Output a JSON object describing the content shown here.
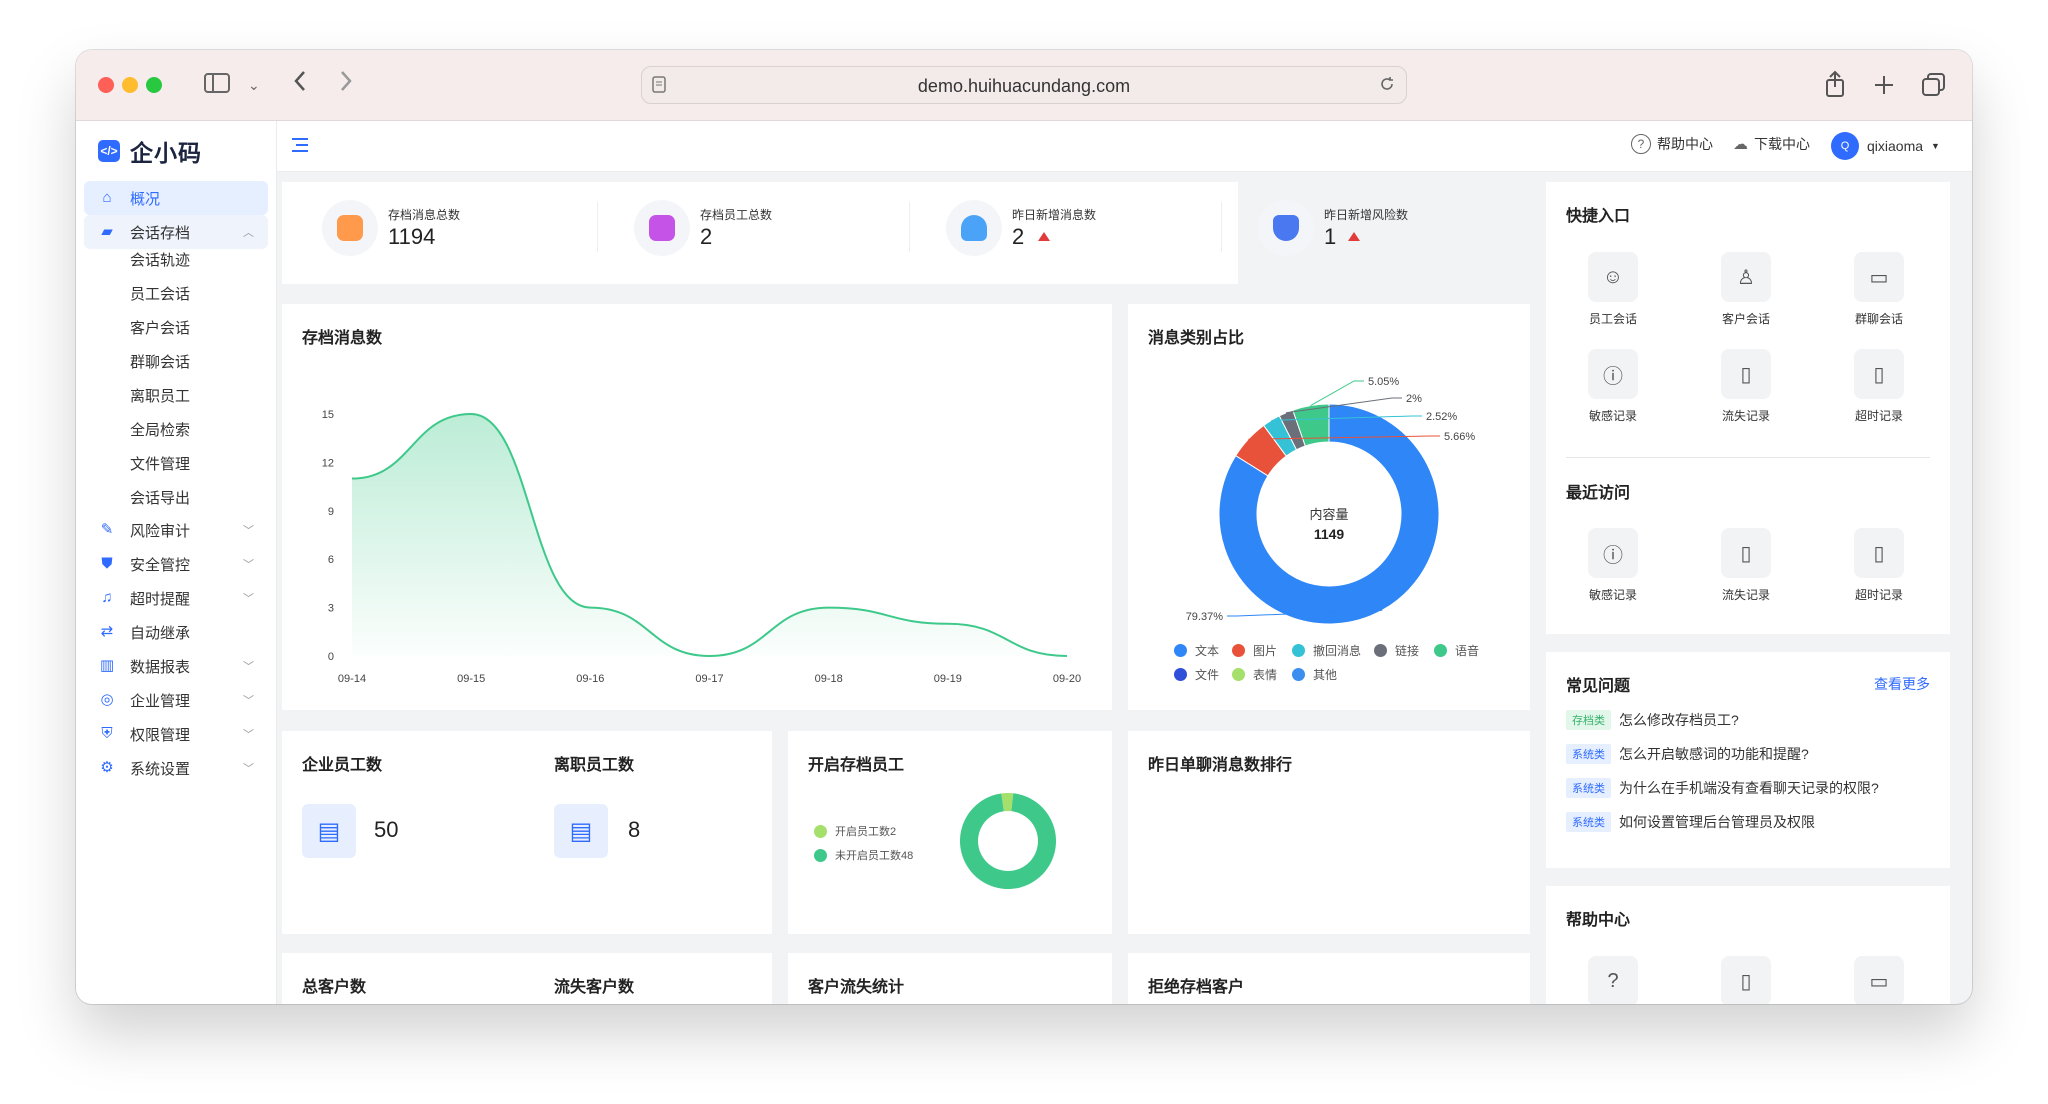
{
  "browser": {
    "url": "demo.huihuacundang.com"
  },
  "brand": {
    "name": "企小码",
    "accent": "#2f6bff"
  },
  "sidebar": {
    "overview": "概况",
    "archive": "会话存档",
    "archive_sub": [
      "会话轨迹",
      "员工会话",
      "客户会话",
      "群聊会话",
      "离职员工",
      "全局检索",
      "文件管理",
      "会话导出"
    ],
    "items": [
      "风险审计",
      "安全管控",
      "超时提醒",
      "自动继承",
      "数据报表",
      "企业管理",
      "权限管理",
      "系统设置"
    ]
  },
  "topbar": {
    "help": "帮助中心",
    "download": "下载中心",
    "user_initial": "Q",
    "username": "qixiaoma"
  },
  "stats": [
    {
      "label": "存档消息总数",
      "value": "1194"
    },
    {
      "label": "存档员工总数",
      "value": "2"
    },
    {
      "label": "昨日新增消息数",
      "value": "2"
    },
    {
      "label": "昨日新增风险数",
      "value": "1"
    }
  ],
  "chart_data": [
    {
      "type": "area",
      "title": "存档消息数",
      "categories": [
        "09-14",
        "09-15",
        "09-16",
        "09-17",
        "09-18",
        "09-19",
        "09-20"
      ],
      "values": [
        11,
        15,
        3,
        0,
        3,
        2,
        0
      ],
      "yticks": [
        0,
        3,
        6,
        9,
        12,
        15
      ],
      "ylim": [
        0,
        15
      ],
      "color": "#3ec98a"
    },
    {
      "type": "pie",
      "title": "消息类别占比",
      "center_label": "内容量",
      "center_value": "1149",
      "slices": [
        {
          "name": "文本",
          "value": 79.37,
          "color": "#2f86f6"
        },
        {
          "name": "图片",
          "value": 5.66,
          "color": "#e8523a"
        },
        {
          "name": "撤回消息",
          "value": 2.52,
          "color": "#35c2d6"
        },
        {
          "name": "链接",
          "value": 2,
          "color": "#6b6f7a"
        },
        {
          "name": "语音",
          "value": 5.05,
          "color": "#3ec98a"
        },
        {
          "name": "文件",
          "value": 0,
          "color": "#2f4fd8"
        },
        {
          "name": "表情",
          "value": 0,
          "color": "#a4e06b"
        },
        {
          "name": "其他",
          "value": 0,
          "color": "#3a8ef0"
        }
      ],
      "slice_labels": [
        "79.37%",
        "5.05%",
        "2%",
        "2.52%",
        "5.66%"
      ]
    },
    {
      "type": "pie",
      "title": "开启存档员工",
      "slices": [
        {
          "name": "开启员工数2",
          "value": 2,
          "color": "#a4e06b"
        },
        {
          "name": "未开启员工数48",
          "value": 48,
          "color": "#3ec98a"
        }
      ]
    }
  ],
  "employees": {
    "title": "企业员工数",
    "value": "50"
  },
  "resigned": {
    "title": "离职员工数",
    "value": "8"
  },
  "ranking": {
    "title": "昨日单聊消息数排行"
  },
  "bottom": {
    "customers": "总客户数",
    "lost_customers": "流失客户数",
    "churn": "客户流失统计",
    "refuse": "拒绝存档客户"
  },
  "quick": {
    "title": "快捷入口",
    "items": [
      "员工会话",
      "客户会话",
      "群聊会话",
      "敏感记录",
      "流失记录",
      "超时记录"
    ],
    "recent_title": "最近访问",
    "recent": [
      "敏感记录",
      "流失记录",
      "超时记录"
    ]
  },
  "faq": {
    "title": "常见问题",
    "more": "查看更多",
    "items": [
      {
        "tag": "存档类",
        "text": "怎么修改存档员工?"
      },
      {
        "tag": "系统类",
        "text": "怎么开启敏感词的功能和提醒?"
      },
      {
        "tag": "系统类",
        "text": "为什么在手机端没有查看聊天记录的权限?"
      },
      {
        "tag": "系统类",
        "text": "如何设置管理后台管理员及权限"
      }
    ]
  },
  "help_center": {
    "title": "帮助中心"
  }
}
